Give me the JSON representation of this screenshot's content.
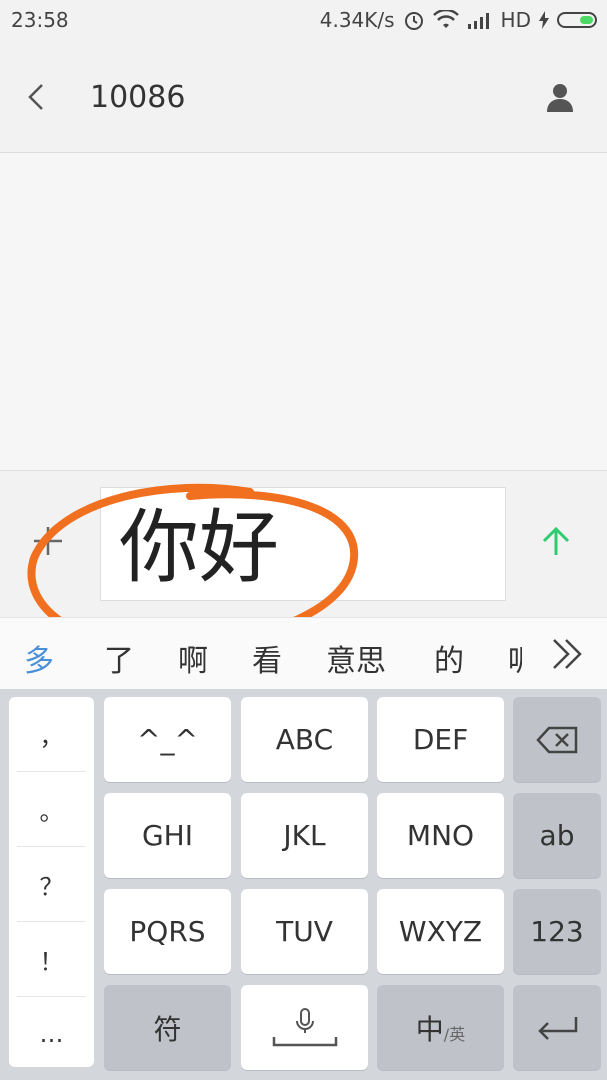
{
  "status": {
    "time": "23:58",
    "speed": "4.34K/s",
    "network": "HD"
  },
  "header": {
    "title": "10086"
  },
  "composer": {
    "text": "你好"
  },
  "candidates": [
    "多",
    "了",
    "啊",
    "看",
    "意思",
    "的",
    "呢"
  ],
  "keyboard": {
    "punctuation": [
      "，",
      "。",
      "？",
      "！",
      "…"
    ],
    "rows": [
      [
        "^_^",
        "ABC",
        "DEF"
      ],
      [
        "GHI",
        "JKL",
        "MNO"
      ],
      [
        "PQRS",
        "TUV",
        "WXYZ"
      ]
    ],
    "side": [
      "ab",
      "123"
    ],
    "symbol_key": "符",
    "lang_key_main": "中",
    "lang_key_sub": "/英"
  },
  "colors": {
    "accent": "#4a90d9",
    "send": "#2ecc71",
    "annotation": "#f07020"
  }
}
